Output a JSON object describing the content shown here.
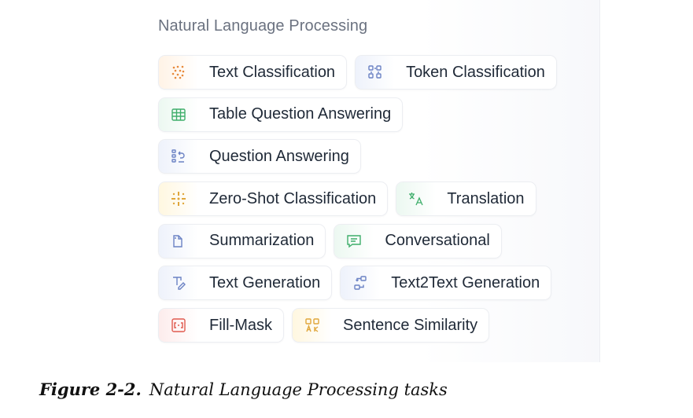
{
  "section": {
    "title": "Natural Language Processing"
  },
  "tasks": [
    [
      {
        "label": "Text Classification",
        "icon": "text-classification-icon",
        "color": "#e8893a"
      },
      {
        "label": "Token Classification",
        "icon": "token-classification-icon",
        "color": "#6b82c4"
      }
    ],
    [
      {
        "label": "Table Question Answering",
        "icon": "table-icon",
        "color": "#3fae6b"
      }
    ],
    [
      {
        "label": "Question Answering",
        "icon": "question-answering-icon",
        "color": "#6b82c4"
      }
    ],
    [
      {
        "label": "Zero-Shot Classification",
        "icon": "zero-shot-icon",
        "color": "#e0a63a"
      },
      {
        "label": "Translation",
        "icon": "translation-icon",
        "color": "#3fae6b"
      }
    ],
    [
      {
        "label": "Summarization",
        "icon": "summarization-icon",
        "color": "#6b82c4"
      },
      {
        "label": "Conversational",
        "icon": "conversational-icon",
        "color": "#3fae6b"
      }
    ],
    [
      {
        "label": "Text Generation",
        "icon": "text-generation-icon",
        "color": "#6b82c4"
      },
      {
        "label": "Text2Text Generation",
        "icon": "text2text-generation-icon",
        "color": "#6b82c4"
      }
    ],
    [
      {
        "label": "Fill-Mask",
        "icon": "fill-mask-icon",
        "color": "#e05a4f"
      },
      {
        "label": "Sentence Similarity",
        "icon": "sentence-similarity-icon",
        "color": "#e0a63a"
      }
    ]
  ],
  "caption": {
    "figure": "Figure 2-2.",
    "text": "Natural Language Processing tasks"
  }
}
